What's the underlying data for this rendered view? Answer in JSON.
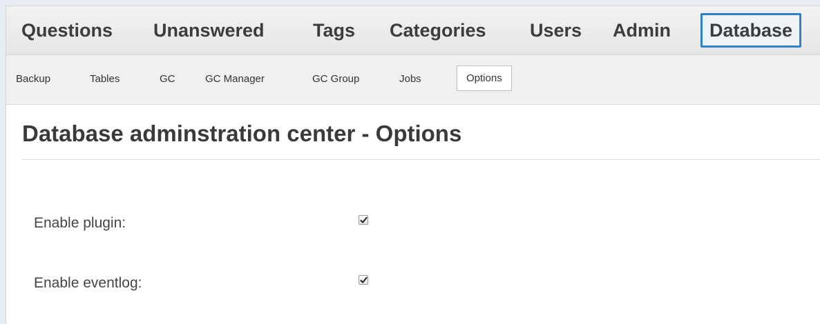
{
  "main_nav": {
    "items": [
      {
        "label": "Questions",
        "active": false
      },
      {
        "label": "Unanswered",
        "active": false
      },
      {
        "label": "Tags",
        "active": false
      },
      {
        "label": "Categories",
        "active": false
      },
      {
        "label": "Users",
        "active": false
      },
      {
        "label": "Admin",
        "active": false
      },
      {
        "label": "Database",
        "active": true
      }
    ]
  },
  "sub_nav": {
    "items": [
      {
        "label": "Backup",
        "active": false
      },
      {
        "label": "Tables",
        "active": false
      },
      {
        "label": "GC",
        "active": false
      },
      {
        "label": "GC Manager",
        "active": false
      },
      {
        "label": "GC Group",
        "active": false
      },
      {
        "label": "Jobs",
        "active": false
      },
      {
        "label": "Options",
        "active": true
      }
    ]
  },
  "page": {
    "title": "Database adminstration center - Options"
  },
  "options": [
    {
      "label": "Enable plugin:",
      "checked": true,
      "icon": "checkmark-icon"
    },
    {
      "label": "Enable eventlog:",
      "checked": true,
      "icon": "checkmark-icon"
    }
  ],
  "colors": {
    "active_border": "#2f7fc9",
    "nav_text": "#3c3c3c"
  }
}
